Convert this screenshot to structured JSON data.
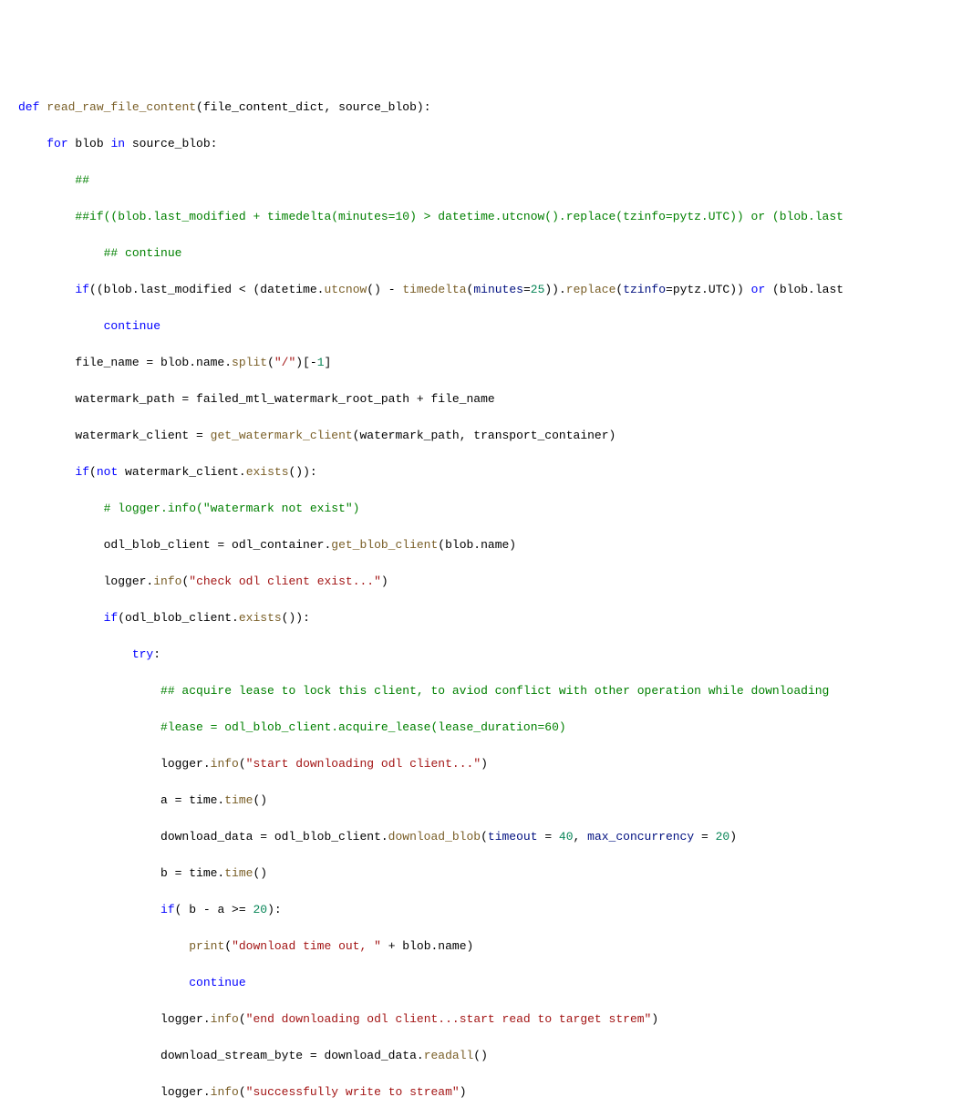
{
  "code": {
    "l1_def": "def",
    "l1_fn": "read_raw_file_content",
    "l1_rest": "(file_content_dict, source_blob):",
    "l2_for": "for",
    "l2_var": " blob ",
    "l2_in": "in",
    "l2_rest": " source_blob:",
    "l3": "        ##",
    "l4a": "        ##if((blob.last_modified + timedelta(minutes=10) > datetime.utcnow().replace(tzinfo=pytz.UTC)) or (blob.last",
    "l5": "            ## continue",
    "l6_if": "if",
    "l6_a": "((blob.last_modified < (datetime.",
    "l6_utcnow": "utcnow",
    "l6_b": "() - ",
    "l6_td": "timedelta",
    "l6_c": "(",
    "l6_min": "minutes",
    "l6_eq": "=",
    "l6_25": "25",
    "l6_d": ")).",
    "l6_replace": "replace",
    "l6_e": "(",
    "l6_tz": "tzinfo",
    "l6_f": "=pytz.UTC)) ",
    "l6_or": "or",
    "l6_g": " (blob.last",
    "l7_cont": "continue",
    "l8_a": "        file_name = blob.name.",
    "l8_split": "split",
    "l8_b": "(",
    "l8_str": "\"/\"",
    "l8_c": ")[-",
    "l8_1": "1",
    "l8_d": "]",
    "l9": "        watermark_path = failed_mtl_watermark_root_path + file_name",
    "l10_a": "        watermark_client = ",
    "l10_fn": "get_watermark_client",
    "l10_b": "(watermark_path, transport_container)",
    "l11_if": "if",
    "l11_a": "(",
    "l11_not": "not",
    "l11_b": " watermark_client.",
    "l11_ex": "exists",
    "l11_c": "()):",
    "l12": "            # logger.info(\"watermark not exist\")",
    "l13_a": "            odl_blob_client = odl_container.",
    "l13_fn": "get_blob_client",
    "l13_b": "(blob.name)",
    "l14_a": "            logger.",
    "l14_fn": "info",
    "l14_b": "(",
    "l14_str": "\"check odl client exist...\"",
    "l14_c": ")",
    "l15_if": "if",
    "l15_a": "(odl_blob_client.",
    "l15_ex": "exists",
    "l15_b": "()):",
    "l16_try": "try",
    "l16_c": ":",
    "l17": "                    ## acquire lease to lock this client, to aviod conflict with other operation while downloading",
    "l18": "                    #lease = odl_blob_client.acquire_lease(lease_duration=60)",
    "l19_a": "                    logger.",
    "l19_fn": "info",
    "l19_b": "(",
    "l19_str": "\"start downloading odl client...\"",
    "l19_c": ")",
    "l20_a": "                    a = time.",
    "l20_fn": "time",
    "l20_b": "()",
    "l21_a": "                    download_data = odl_blob_client.",
    "l21_fn": "download_blob",
    "l21_b": "(",
    "l21_to": "timeout",
    "l21_c": " = ",
    "l21_40": "40",
    "l21_d": ", ",
    "l21_mc": "max_concurrency",
    "l21_e": " = ",
    "l21_20": "20",
    "l21_f": ")",
    "l22_a": "                    b = time.",
    "l22_fn": "time",
    "l22_b": "()",
    "l23_if": "if",
    "l23_a": "( b - a >= ",
    "l23_20": "20",
    "l23_b": "):",
    "l24_a": "                        ",
    "l24_fn": "print",
    "l24_b": "(",
    "l24_str": "\"download time out, \"",
    "l24_c": " + blob.name)",
    "l25_cont": "continue",
    "l26_a": "                    logger.",
    "l26_fn": "info",
    "l26_b": "(",
    "l26_str": "\"end downloading odl client...start read to target strem\"",
    "l26_c": ")",
    "l27_a": "                    download_stream_byte = download_data.",
    "l27_fn": "readall",
    "l27_b": "()",
    "l28_a": "                    logger.",
    "l28_fn": "info",
    "l28_b": "(",
    "l28_str": "\"successfully write to stream\"",
    "l28_c": ")"
  }
}
